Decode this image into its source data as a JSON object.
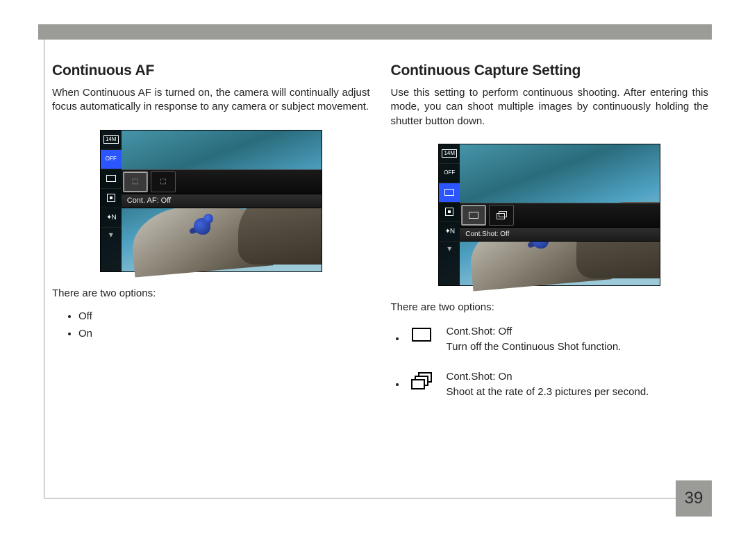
{
  "page_number": "39",
  "left": {
    "heading": "Continuous AF",
    "body": "When Continuous AF is turned on, the camera will continually adjust focus automatically in response to any camera or subject movement.",
    "options_intro": "There are two options:",
    "options": {
      "opt1": "Off",
      "opt2": "On"
    },
    "screenshot_label": "Cont. AF: Off",
    "side_14m": "14M",
    "side_af_off": "OFF",
    "side_star": "✦N"
  },
  "right": {
    "heading": "Continuous Capture Setting",
    "body": "Use this setting to perform continuous shooting. After entering this mode, you can shoot multiple images by continuously holding the shutter button down.",
    "options_intro": "There are two options:",
    "screenshot_label": "Cont.Shot: Off",
    "side_14m": "14M",
    "side_af_off": "OFF",
    "side_star": "✦N",
    "opt1_title": "Cont.Shot: Off",
    "opt1_desc": "Turn off the Continuous Shot function.",
    "opt2_title": "Cont.Shot: On",
    "opt2_desc": "Shoot at the rate of 2.3 pictures per second."
  }
}
